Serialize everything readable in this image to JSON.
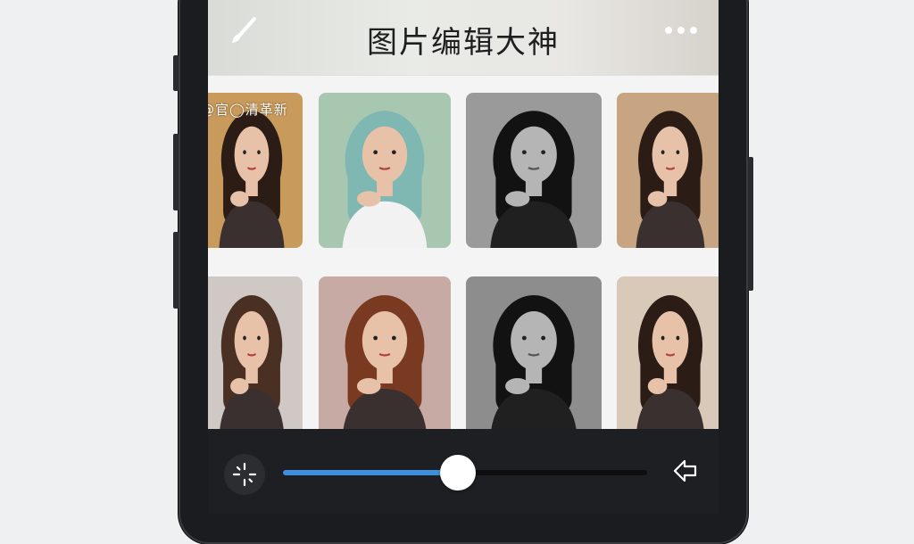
{
  "app": {
    "title": "图片编辑大神",
    "watermark": "@官◯清革新"
  },
  "header": {
    "left_icon": "brush-icon",
    "right_icon": "more-dots-icon"
  },
  "grid": {
    "rows": [
      [
        {
          "style": "warm-golden",
          "hair": "dark-brown",
          "tone": "#c89a5c"
        },
        {
          "style": "pastel-teal-hair",
          "hair": "teal",
          "tone": "#a8c7b0"
        },
        {
          "style": "black-and-white",
          "hair": "black",
          "tone": "#9a9a9a"
        },
        {
          "style": "warm-sepia",
          "hair": "dark-brown",
          "tone": "#c7a582"
        }
      ],
      [
        {
          "style": "natural-soft",
          "hair": "brown",
          "tone": "#cfc8c4"
        },
        {
          "style": "warm-red-hair",
          "hair": "auburn",
          "tone": "#c7aaa3"
        },
        {
          "style": "monochrome",
          "hair": "black",
          "tone": "#8d8d8d"
        },
        {
          "style": "warm-vintage",
          "hair": "dark-brown",
          "tone": "#d8c9b8"
        }
      ]
    ]
  },
  "toolbar": {
    "left_icon": "adjust-sparkle-icon",
    "right_icon": "share-icon",
    "slider_value": 0.48,
    "accent": "#3d8fe0"
  }
}
